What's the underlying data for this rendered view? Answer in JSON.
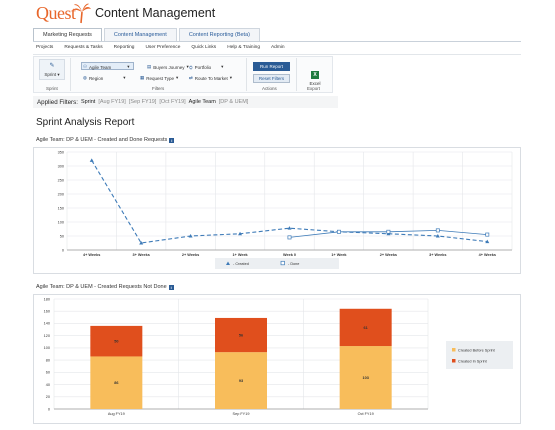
{
  "header": {
    "logo": "Quest",
    "app_title": "Content Management"
  },
  "tabs": [
    {
      "label": "Marketing Requests",
      "active": true
    },
    {
      "label": "Content Management",
      "active": false
    },
    {
      "label": "Content Reporting (Beta)",
      "active": false
    }
  ],
  "menu": [
    "Projects",
    "Requests & Tasks",
    "Reporting",
    "User Preference",
    "Quick Links",
    "Help & Training",
    "Admin"
  ],
  "ribbon": {
    "sprint_label": "Sprint",
    "sprint_group": "Sprint",
    "filters_group": "Filters",
    "actions_group": "Actions",
    "export_group": "Export",
    "filters": [
      "Agile Team",
      "Buyers Journey",
      "Portfolio",
      "Region",
      "Request Type",
      "Route To Market"
    ],
    "run_report": "Run Report",
    "reset_filters": "Reset Filters",
    "excel": "Excel"
  },
  "applied_filters": {
    "label": "Applied Filters:",
    "sprint_label": "Sprint",
    "sprint_tags": [
      "[Aug FY19]",
      "[Sep FY19]",
      "[Oct FY19]"
    ],
    "team_label": "Agile Team",
    "team_tags": [
      "[DP & UEM]"
    ]
  },
  "report_title": "Sprint Analysis Report",
  "colors": {
    "brand": "#e8662a",
    "nav_blue": "#2a5b95",
    "line": "#3e7bb8",
    "created_before": "#f8bd5b",
    "created_in": "#e04f1d"
  },
  "chart_data": [
    {
      "type": "line",
      "title": "Agile Team: DP & UEM - Created and Done Requests",
      "categories": [
        "4+ Weeks",
        "3+ Weeks",
        "2+ Weeks",
        "1+ Week",
        "Week 0",
        "1+ Week",
        "2+ Weeks",
        "3+ Weeks",
        "4+ Weeks"
      ],
      "ylim": [
        0,
        350
      ],
      "yticks": [
        0,
        50,
        100,
        150,
        200,
        250,
        300,
        350
      ],
      "grid": true,
      "legend": "bottom-center",
      "series": [
        {
          "name": "Created",
          "style": "dashed",
          "marker": "triangle",
          "values": [
            320,
            25,
            50,
            58,
            78,
            65,
            58,
            50,
            30
          ]
        },
        {
          "name": "Done",
          "style": "solid",
          "marker": "square",
          "values": [
            null,
            null,
            null,
            null,
            45,
            65,
            65,
            70,
            55
          ]
        }
      ]
    },
    {
      "type": "bar",
      "stacked": true,
      "title": "Agile Team: DP & UEM - Created Requests Not Done",
      "categories": [
        "Aug FY19",
        "Sep FY19",
        "Oct FY19"
      ],
      "ylim": [
        0,
        180
      ],
      "yticks": [
        0,
        20,
        40,
        60,
        80,
        100,
        120,
        140,
        160,
        180
      ],
      "grid": true,
      "legend": "right",
      "series": [
        {
          "name": "Created Before Sprint",
          "values": [
            86,
            93,
            103
          ]
        },
        {
          "name": "Created In Sprint",
          "values": [
            50,
            56,
            61
          ]
        }
      ]
    }
  ]
}
